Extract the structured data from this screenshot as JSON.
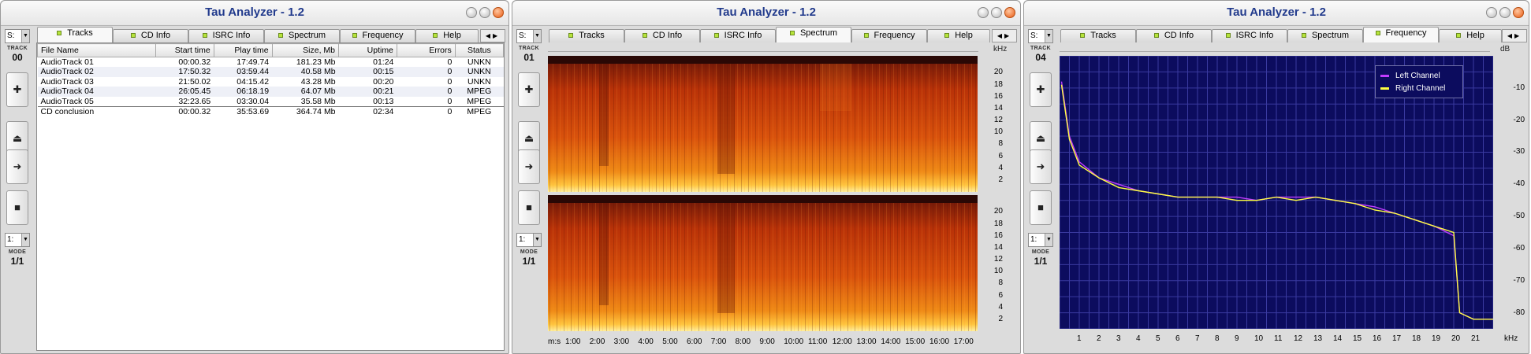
{
  "app_title": "Tau Analyzer - 1.2",
  "sidebar": {
    "source_select": "S:",
    "track_label": "TRACK",
    "mode_select": "1:",
    "mode_label": "MODE",
    "mode_value": "1/1",
    "icons": [
      "add-icon",
      "eject-icon",
      "next-icon",
      "stop-icon"
    ]
  },
  "tabs": [
    "Tracks",
    "CD Info",
    "ISRC Info",
    "Spectrum",
    "Frequency",
    "Help"
  ],
  "windows": [
    {
      "track": "00",
      "active_tab": "Tracks"
    },
    {
      "track": "01",
      "active_tab": "Spectrum"
    },
    {
      "track": "04",
      "active_tab": "Frequency"
    }
  ],
  "tracks_table": {
    "columns": [
      "File Name",
      "Start time",
      "Play time",
      "Size, Mb",
      "Uptime",
      "Errors",
      "Status"
    ],
    "rows": [
      [
        "AudioTrack 01",
        "00:00.32",
        "17:49.74",
        "181.23 Mb",
        "01:24",
        "0",
        "UNKN"
      ],
      [
        "AudioTrack 02",
        "17:50.32",
        "03:59.44",
        "40.58 Mb",
        "00:15",
        "0",
        "UNKN"
      ],
      [
        "AudioTrack 03",
        "21:50.02",
        "04:15.42",
        "43.28 Mb",
        "00:20",
        "0",
        "UNKN"
      ],
      [
        "AudioTrack 04",
        "26:05.45",
        "06:18.19",
        "64.07 Mb",
        "00:21",
        "0",
        "MPEG"
      ],
      [
        "AudioTrack 05",
        "32:23.65",
        "03:30.04",
        "35.58 Mb",
        "00:13",
        "0",
        "MPEG"
      ]
    ],
    "summary": [
      "CD conclusion",
      "00:00.32",
      "35:53.69",
      "364.74 Mb",
      "02:34",
      "0",
      "MPEG"
    ]
  },
  "spectrum": {
    "unit_label": "kHz",
    "khz_ticks": [
      "20",
      "18",
      "16",
      "14",
      "12",
      "10",
      "8",
      "6",
      "4",
      "2"
    ],
    "time_axis_label": "m:s",
    "time_ticks": [
      "1:00",
      "2:00",
      "3:00",
      "4:00",
      "5:00",
      "6:00",
      "7:00",
      "8:00",
      "9:00",
      "10:00",
      "11:00",
      "12:00",
      "13:00",
      "14:00",
      "15:00",
      "16:00",
      "17:00"
    ]
  },
  "frequency": {
    "db_label": "dB",
    "khz_label": "kHz",
    "db_ticks": [
      "-10",
      "-20",
      "-30",
      "-40",
      "-50",
      "-60",
      "-70",
      "-80"
    ],
    "khz_ticks": [
      "1",
      "2",
      "3",
      "4",
      "5",
      "6",
      "7",
      "8",
      "9",
      "10",
      "11",
      "12",
      "13",
      "14",
      "15",
      "16",
      "17",
      "18",
      "19",
      "20",
      "21"
    ],
    "legend": [
      {
        "name": "Left Channel",
        "color": "#c03cff"
      },
      {
        "name": "Right Channel",
        "color": "#ffff40"
      }
    ]
  },
  "chart_data": {
    "type": "line",
    "xlabel": "kHz",
    "ylabel": "dB",
    "xlim": [
      0,
      22
    ],
    "ylim": [
      -85,
      0
    ],
    "series": [
      {
        "name": "Left Channel",
        "x": [
          0.1,
          0.5,
          1,
          2,
          3,
          4,
          5,
          6,
          7,
          8,
          9,
          10,
          11,
          12,
          13,
          14,
          15,
          16,
          17,
          18,
          19,
          20,
          20.3,
          21,
          22
        ],
        "y": [
          -8,
          -25,
          -33,
          -38,
          -40,
          -42,
          -43,
          -44,
          -44,
          -44,
          -44,
          -45,
          -44,
          -44,
          -44,
          -45,
          -46,
          -47,
          -49,
          -51,
          -53,
          -56,
          -80,
          -82,
          -82
        ]
      },
      {
        "name": "Right Channel",
        "x": [
          0.1,
          0.5,
          1,
          2,
          3,
          4,
          5,
          6,
          7,
          8,
          9,
          10,
          11,
          12,
          13,
          14,
          15,
          16,
          17,
          18,
          19,
          20,
          20.3,
          21,
          22
        ],
        "y": [
          -9,
          -26,
          -34,
          -38,
          -41,
          -42,
          -43,
          -44,
          -44,
          -44,
          -45,
          -45,
          -44,
          -45,
          -44,
          -45,
          -46,
          -48,
          -49,
          -51,
          -53,
          -55,
          -80,
          -82,
          -82
        ]
      }
    ]
  }
}
